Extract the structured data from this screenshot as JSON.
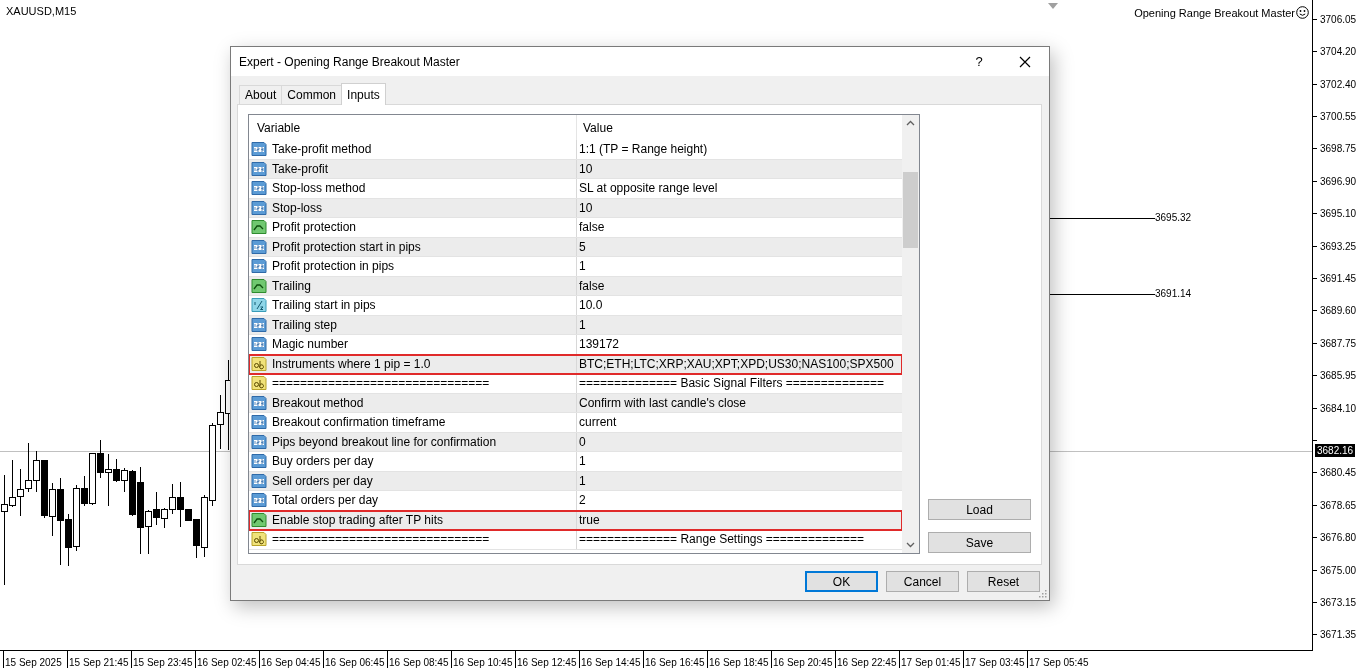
{
  "chart": {
    "symbol": "XAUUSD,M15",
    "expert": "Opening Range Breakout Master",
    "price_axis": [
      "3706.05",
      "3704.20",
      "3702.40",
      "3700.55",
      "3698.75",
      "3696.90",
      "3695.10",
      "3693.25",
      "3691.45",
      "3689.60",
      "3687.75",
      "3685.95",
      "3684.10",
      "3680.45",
      "3678.65",
      "3676.80",
      "3675.00",
      "3673.15",
      "3671.35"
    ],
    "current_price": "3682.16",
    "levels": [
      {
        "label": "3695.32"
      },
      {
        "label": "3691.14"
      }
    ],
    "time_axis": [
      "15 Sep 2025",
      "15 Sep 21:45",
      "15 Sep 23:45",
      "16 Sep 02:45",
      "16 Sep 04:45",
      "16 Sep 06:45",
      "16 Sep 08:45",
      "16 Sep 10:45",
      "16 Sep 12:45",
      "16 Sep 14:45",
      "16 Sep 16:45",
      "16 Sep 18:45",
      "16 Sep 20:45",
      "16 Sep 22:45",
      "17 Sep 01:45",
      "17 Sep 03:45",
      "17 Sep 05:45"
    ]
  },
  "dialog": {
    "title": "Expert - Opening Range Breakout Master",
    "help": "?",
    "tabs": [
      {
        "label": "About",
        "selected": false
      },
      {
        "label": "Common",
        "selected": false
      },
      {
        "label": "Inputs",
        "selected": true
      }
    ],
    "columns": [
      "Variable",
      "Value"
    ],
    "rows": [
      {
        "kind": "int",
        "variable": "Take-profit method",
        "value": "1:1 (TP = Range height)",
        "highlighted": false
      },
      {
        "kind": "int",
        "variable": "Take-profit",
        "value": "10",
        "highlighted": false
      },
      {
        "kind": "int",
        "variable": "Stop-loss method",
        "value": "SL at opposite range level",
        "highlighted": false
      },
      {
        "kind": "int",
        "variable": "Stop-loss",
        "value": "10",
        "highlighted": false
      },
      {
        "kind": "bool",
        "variable": "Profit protection",
        "value": "false",
        "highlighted": false
      },
      {
        "kind": "int",
        "variable": "Profit protection start in pips",
        "value": "5",
        "highlighted": false
      },
      {
        "kind": "int",
        "variable": "Profit protection in pips",
        "value": "1",
        "highlighted": false
      },
      {
        "kind": "bool",
        "variable": "Trailing",
        "value": "false",
        "highlighted": false
      },
      {
        "kind": "double",
        "variable": "Trailing start in pips",
        "value": "10.0",
        "highlighted": false
      },
      {
        "kind": "int",
        "variable": "Trailing step",
        "value": "1",
        "highlighted": false
      },
      {
        "kind": "int",
        "variable": "Magic number",
        "value": "139172",
        "highlighted": false
      },
      {
        "kind": "string",
        "variable": "Instruments where 1 pip = 1.0",
        "value": "BTC;ETH;LTC;XRP;XAU;XPT;XPD;US30;NAS100;SPX500",
        "highlighted": true
      },
      {
        "kind": "string",
        "variable": "===============================",
        "value": "============== Basic Signal Filters ==============",
        "highlighted": false
      },
      {
        "kind": "int",
        "variable": "Breakout method",
        "value": "Confirm with last candle's close",
        "highlighted": false
      },
      {
        "kind": "int",
        "variable": "Breakout confirmation timeframe",
        "value": "current",
        "highlighted": false
      },
      {
        "kind": "int",
        "variable": "Pips beyond breakout line for confirmation",
        "value": "0",
        "highlighted": false
      },
      {
        "kind": "int",
        "variable": "Buy orders per day",
        "value": "1",
        "highlighted": false
      },
      {
        "kind": "int",
        "variable": "Sell orders per day",
        "value": "1",
        "highlighted": false
      },
      {
        "kind": "int",
        "variable": "Total orders per day",
        "value": "2",
        "highlighted": false
      },
      {
        "kind": "bool",
        "variable": "Enable stop trading after TP hits",
        "value": "true",
        "highlighted": true
      },
      {
        "kind": "string",
        "variable": "===============================",
        "value": "============== Range Settings ==============",
        "highlighted": false
      }
    ],
    "side_buttons": [
      "Load",
      "Save"
    ],
    "buttons": [
      {
        "label": "OK",
        "default": true
      },
      {
        "label": "Cancel",
        "default": false
      },
      {
        "label": "Reset",
        "default": false
      }
    ]
  }
}
